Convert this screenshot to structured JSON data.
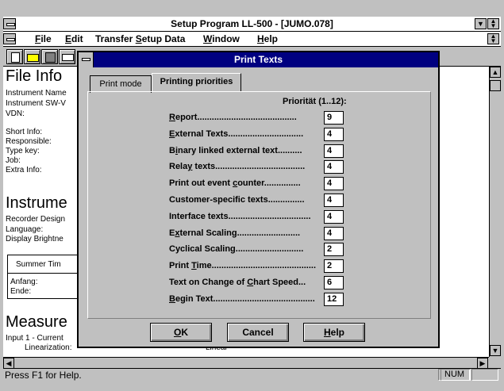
{
  "main_window": {
    "title": "Setup Program LL-500 - [JUMO.078]",
    "menu": [
      "File",
      "Edit",
      "Transfer Setup Data",
      "Window",
      "Help"
    ],
    "menu_underline": [
      "F",
      "E",
      "S",
      "W",
      "H"
    ]
  },
  "background_doc": {
    "section1": "File Info",
    "fields1": [
      "Instrument Name",
      "Instrument SW-V",
      "VDN:",
      "Short Info:",
      "Responsible:",
      "Type key:",
      "Job:",
      "Extra Info:"
    ],
    "section2": "Instrume",
    "fields2": [
      "Recorder Design",
      "Language:",
      "Display Brightne"
    ],
    "summer_box_title": "Summer Tim",
    "summer_fields": [
      "Anfang:",
      "Ende:"
    ],
    "section3": "Measure",
    "fields3": [
      "Input 1 - Current",
      "Linearization:"
    ],
    "fields3_value": "Linear"
  },
  "status_bar": {
    "text": "Press F1 for Help.",
    "num": "NUM"
  },
  "dialog": {
    "title": "Print Texts",
    "tabs": [
      "Print mode",
      "Printing priorities"
    ],
    "active_tab": "Printing priorities",
    "column_header": "Priorität (1..12):",
    "rows": [
      {
        "pre": "",
        "u": "R",
        "post": "eport.........................................",
        "value": "9"
      },
      {
        "pre": "",
        "u": "E",
        "post": "xternal Texts...............................",
        "value": "4"
      },
      {
        "pre": "B",
        "u": "i",
        "post": "nary linked external text..........",
        "value": "4"
      },
      {
        "pre": "Rela",
        "u": "y",
        "post": " texts.....................................",
        "value": "4"
      },
      {
        "pre": "Print out event ",
        "u": "c",
        "post": "ounter...............",
        "value": "4"
      },
      {
        "pre": "Customer-specific texts...............",
        "u": "",
        "post": "",
        "value": "4"
      },
      {
        "pre": "Interface texts..................................",
        "u": "",
        "post": "",
        "value": "4"
      },
      {
        "pre": "E",
        "u": "x",
        "post": "ternal Scaling..........................",
        "value": "4"
      },
      {
        "pre": "Cyclical Scaling............................",
        "u": "",
        "post": "",
        "value": "2"
      },
      {
        "pre": "Print ",
        "u": "T",
        "post": "ime...........................................",
        "value": "2"
      },
      {
        "pre": "Text on Change of ",
        "u": "C",
        "post": "hart Speed...",
        "value": "6"
      },
      {
        "pre": "",
        "u": "B",
        "post": "egin Text..........................................",
        "value": "12"
      }
    ],
    "buttons": [
      {
        "pre": "",
        "u": "O",
        "post": "K"
      },
      {
        "pre": "Cancel",
        "u": "",
        "post": ""
      },
      {
        "pre": "",
        "u": "H",
        "post": "elp"
      }
    ]
  }
}
